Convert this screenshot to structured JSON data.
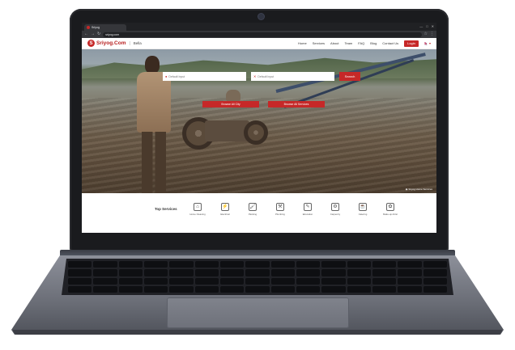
{
  "browser": {
    "tab_title": "Sriyog",
    "url": "sriyog.com",
    "window_controls": [
      "—",
      "□",
      "✕"
    ]
  },
  "header": {
    "logo_mark": "S",
    "logo_text": "Sriyog.Com",
    "logo_sub": "Bella",
    "nav": [
      "Home",
      "Services",
      "About",
      "Team",
      "FAQ",
      "Blog",
      "Contact Us"
    ],
    "login_label": "Login",
    "lang": "🇳🇵 ▾"
  },
  "hero": {
    "location_placeholder": "Default Input",
    "service_placeholder": "Default Input",
    "search_label": "Search",
    "cta_city": "Browse All City",
    "cta_services": "Browse All Services",
    "caption": "Sriyog Home Services"
  },
  "services": {
    "title": "Top Services",
    "items": [
      {
        "label": "Home Cleaning",
        "icon": "home-cleaning-icon",
        "glyph": "⌂"
      },
      {
        "label": "Electrical",
        "icon": "electrical-icon",
        "glyph": "⚡"
      },
      {
        "label": "Painting",
        "icon": "painting-icon",
        "glyph": "🖌"
      },
      {
        "label": "Plumbing",
        "icon": "plumbing-icon",
        "glyph": "⚒"
      },
      {
        "label": "Education",
        "icon": "education-icon",
        "glyph": "✎"
      },
      {
        "label": "Carpentry",
        "icon": "carpentry-icon",
        "glyph": "⚙"
      },
      {
        "label": "Catering",
        "icon": "catering-icon",
        "glyph": "☕"
      },
      {
        "label": "Make-up Artist",
        "icon": "makeup-icon",
        "glyph": "✿"
      }
    ]
  },
  "colors": {
    "brand": "#c62828",
    "browser_dark": "#202124"
  }
}
